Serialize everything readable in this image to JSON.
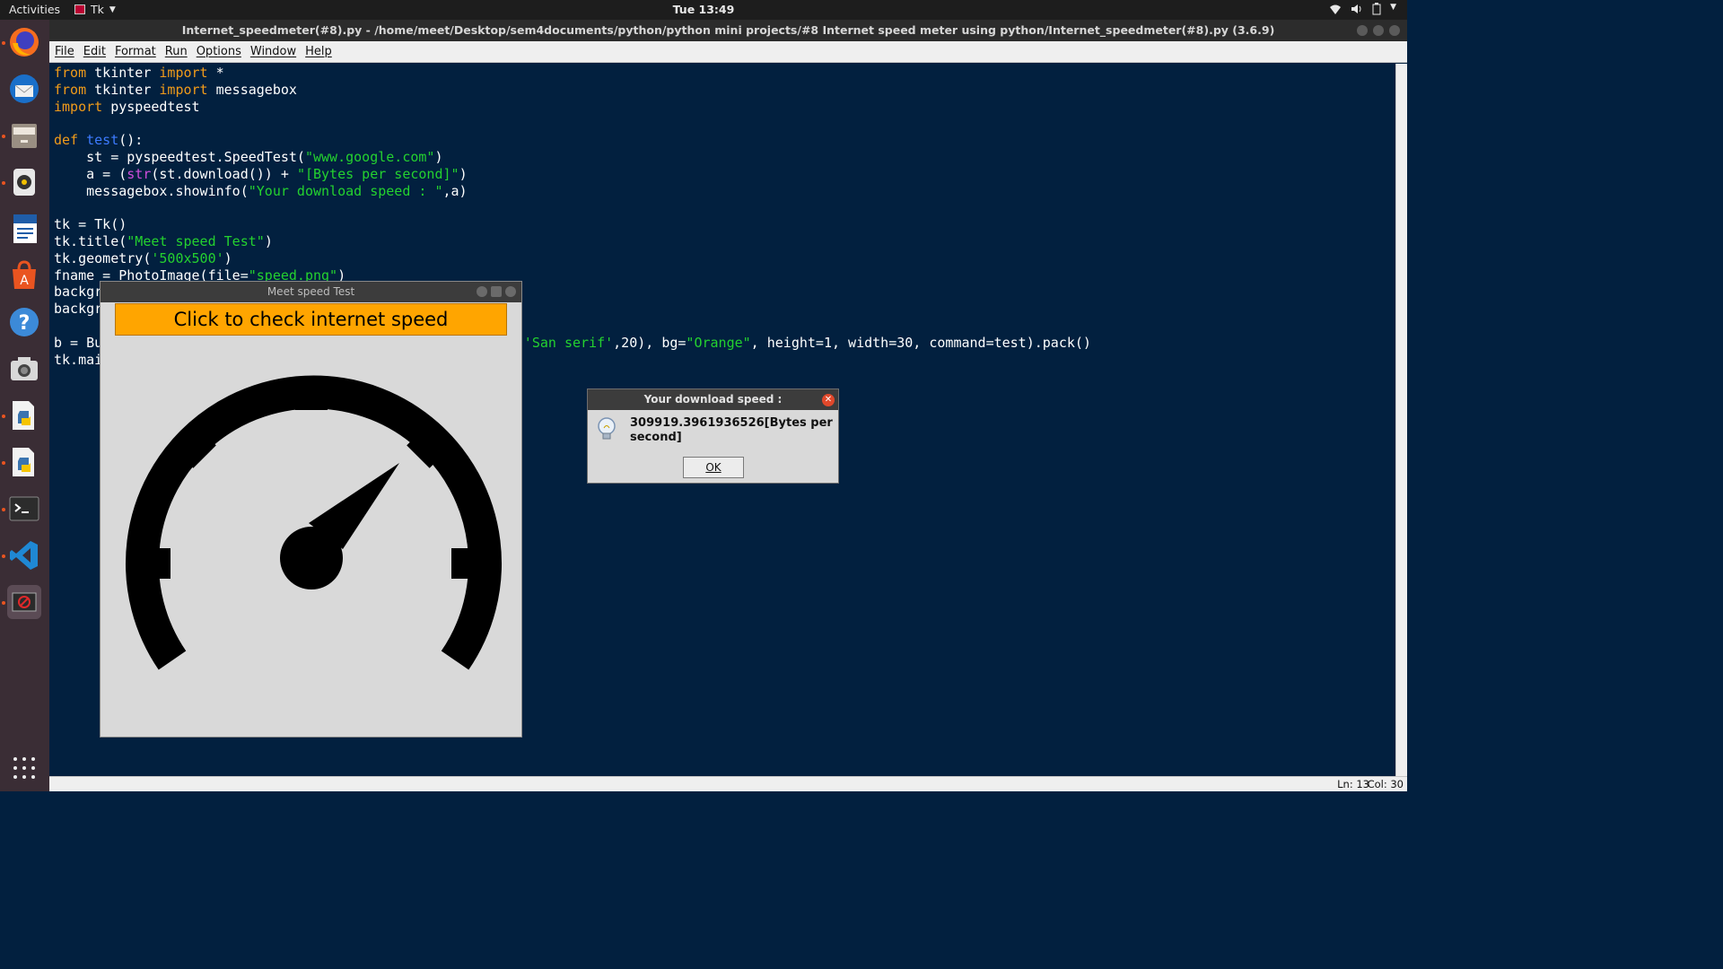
{
  "topbar": {
    "activities": "Activities",
    "app_name": "Tk",
    "clock": "Tue 13:49"
  },
  "dock": {
    "apps": [
      "firefox-icon",
      "thunderbird-icon",
      "files-icon",
      "rhythmbox-icon",
      "writer-icon",
      "software-icon",
      "help-icon",
      "screenshot-icon",
      "idle-python-icon",
      "idle-python-icon-2",
      "terminal-icon",
      "vscode-icon",
      "tk-app-icon"
    ]
  },
  "idle": {
    "title": "Internet_speedmeter(#8).py - /home/meet/Desktop/sem4documents/python/python mini projects/#8 Internet speed meter using python/Internet_speedmeter(#8).py (3.6.9)",
    "menu": [
      "File",
      "Edit",
      "Format",
      "Run",
      "Options",
      "Window",
      "Help"
    ],
    "status_ln": "Ln: 13",
    "status_col": "Col: 30"
  },
  "code": {
    "l1_kw": "from",
    "l1_a": " tkinter ",
    "l1_kw2": "import",
    "l1_b": " *",
    "l2_kw": "from",
    "l2_a": " tkinter ",
    "l2_kw2": "import",
    "l2_b": " messagebox",
    "l3_kw": "import",
    "l3_a": " pyspeedtest",
    "l5_kw": "def",
    "l5_sp": " ",
    "l5_fn": "test",
    "l5_a": "():",
    "l6_a": "    st = pyspeedtest.SpeedTest(",
    "l6_s": "\"www.google.com\"",
    "l6_b": ")",
    "l7_a": "    a = (",
    "l7_bi": "str",
    "l7_b": "(st.download()) + ",
    "l7_s": "\"[Bytes per second]\"",
    "l7_c": ")",
    "l8_a": "    messagebox.showinfo(",
    "l8_s": "\"Your download speed : \"",
    "l8_b": ",a)",
    "l10": "tk = Tk()",
    "l11_a": "tk.title(",
    "l11_s": "\"Meet speed Test\"",
    "l11_b": ")",
    "l12_a": "tk.geometry(",
    "l12_s": "'500x500'",
    "l12_b": ")",
    "l13_a": "fname = PhotoImage(file=",
    "l13_s": "\"speed.png\"",
    "l13_b": ")",
    "l14": "backgr",
    "l15": "backgr",
    "l17_a": "b = Bu",
    "l17_pad": "                                                   ",
    "l17_b": "(",
    "l17_s": "'San serif'",
    "l17_c": ",20), bg=",
    "l17_s2": "\"Orange\"",
    "l17_d": ", height=1, width=30, command=test).pack()",
    "l18": "tk.mai"
  },
  "tk_window": {
    "title": "Meet speed Test",
    "button_label": "Click to check internet speed"
  },
  "messagebox": {
    "title": "Your download speed :",
    "message": "309919.3961936526[Bytes per second]",
    "ok_label": "OK"
  },
  "colors": {
    "editor_bg": "#02203f",
    "keyword": "#f09b1a",
    "string": "#24d12f",
    "builtin": "#d04edc",
    "function": "#3d7bff",
    "button_bg": "#ffa500"
  }
}
